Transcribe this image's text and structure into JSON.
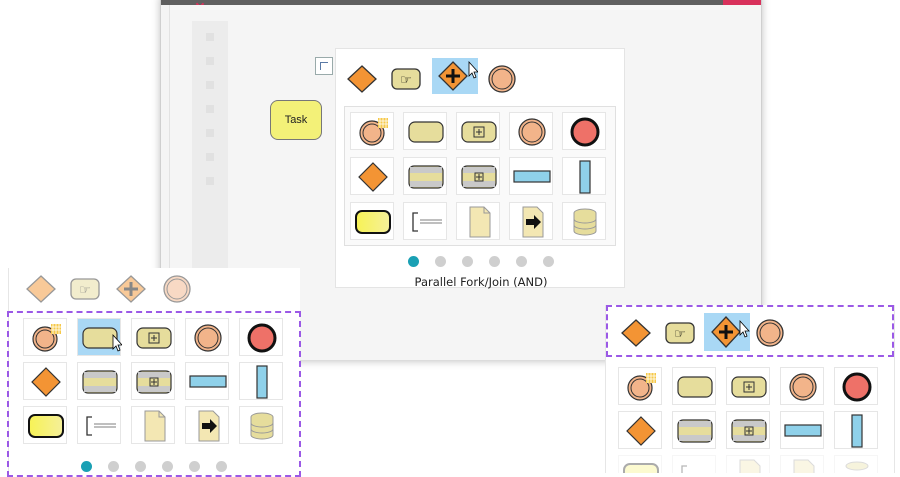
{
  "task_node": {
    "label": "Task"
  },
  "palette_main": {
    "caption": "Parallel Fork/Join (AND)",
    "page_count": 6,
    "active_page": 0
  },
  "top_tools": [
    {
      "name": "exclusive-gateway-icon"
    },
    {
      "name": "hand-pointer-icon"
    },
    {
      "name": "parallel-gateway-icon"
    },
    {
      "name": "event-circle-icon"
    }
  ],
  "grid_tools": [
    "timer-event-icon",
    "task-shape-icon",
    "subprocess-icon",
    "intermediate-event-icon",
    "end-event-icon",
    "gateway-diamond-icon",
    "striped-task-icon",
    "striped-subprocess-icon",
    "horizontal-pool-icon",
    "vertical-pool-icon",
    "yellow-task-icon",
    "annotation-bracket-icon",
    "data-object-icon",
    "data-input-icon",
    "data-store-icon"
  ],
  "colors": {
    "orange": "#f39434",
    "peach": "#f2b48a",
    "yellow": "#e8e79a",
    "khaki": "#e6dd9c",
    "red": "#ee7168",
    "blue": "#8fd1ea",
    "selected": "#a9d8f5",
    "dash": "#9b59e6",
    "page_active": "#1aa0b4"
  }
}
